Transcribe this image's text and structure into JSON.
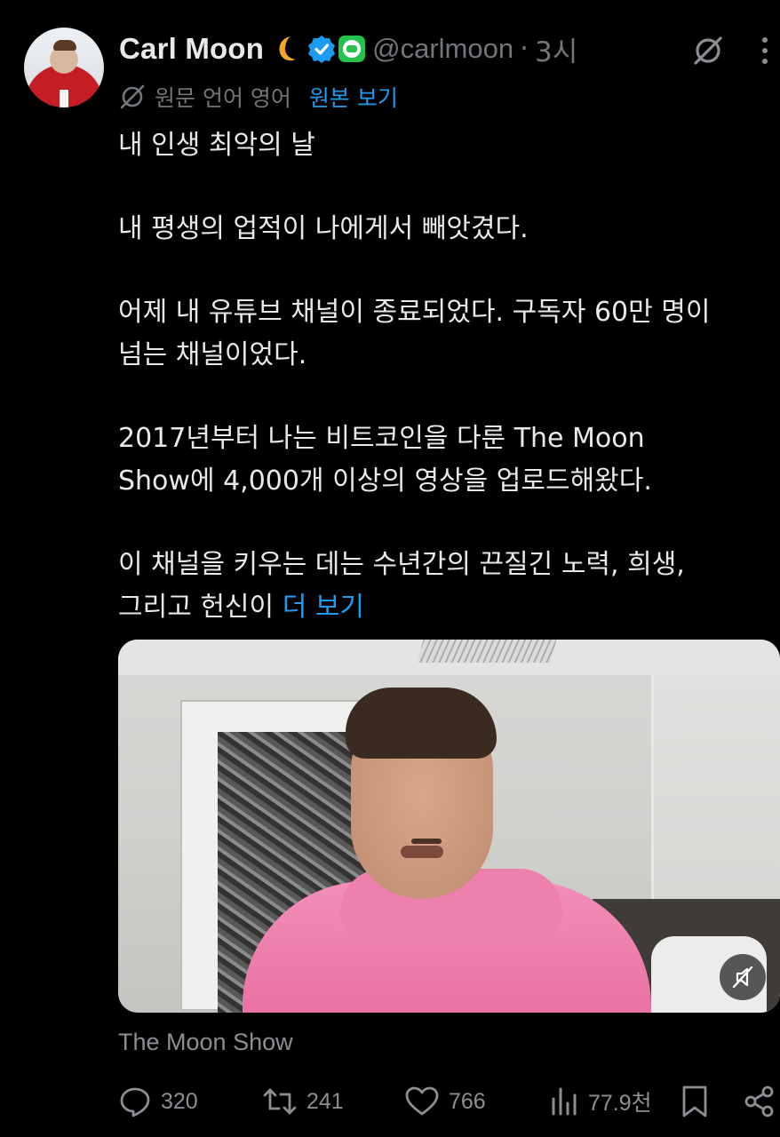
{
  "tweet": {
    "author": {
      "name": "Carl Moon",
      "handle": "@carlmoon",
      "time": "3시"
    },
    "translation": {
      "label": "원문 언어 영어",
      "original_link": "원본 보기"
    },
    "paragraphs": [
      "내 인생 최악의 날",
      "내 평생의 업적이 나에게서 빼앗겼다.",
      "어제 내 유튜브 채널이 종료되었다. 구독자 60만 명이\n넘는 채널이었다.",
      "2017년부터 나는 비트코인을 다룬 The Moon\nShow에 4,000개 이상의 영상을 업로드해왔다."
    ],
    "last_paragraph_text": "이 채널을 키우는 데는 수년간의 끈질긴 노력, 희생,\n그리고 헌신이 ",
    "more_link": "더 보기",
    "media_caption": "The Moon Show",
    "actions": {
      "replies": "320",
      "reposts": "241",
      "likes": "766",
      "views": "77.9천"
    },
    "colors": {
      "background": "#000000",
      "text": "#e7e9ea",
      "muted": "#71767b",
      "link": "#1d9bf0",
      "verified": "#1d9bf0",
      "affiliate_badge": "#27c24c"
    },
    "icons": {
      "moon_emoji": "crescent-moon",
      "verified": "verified-badge-icon",
      "affiliate": "affiliate-badge-icon",
      "grok": "grok-icon",
      "more": "more-vertical-icon",
      "translate": "translate-icon",
      "mute": "mute-icon",
      "reply": "reply-icon",
      "repost": "repost-icon",
      "like": "like-icon",
      "views": "views-icon",
      "bookmark": "bookmark-icon",
      "share": "share-icon"
    }
  }
}
